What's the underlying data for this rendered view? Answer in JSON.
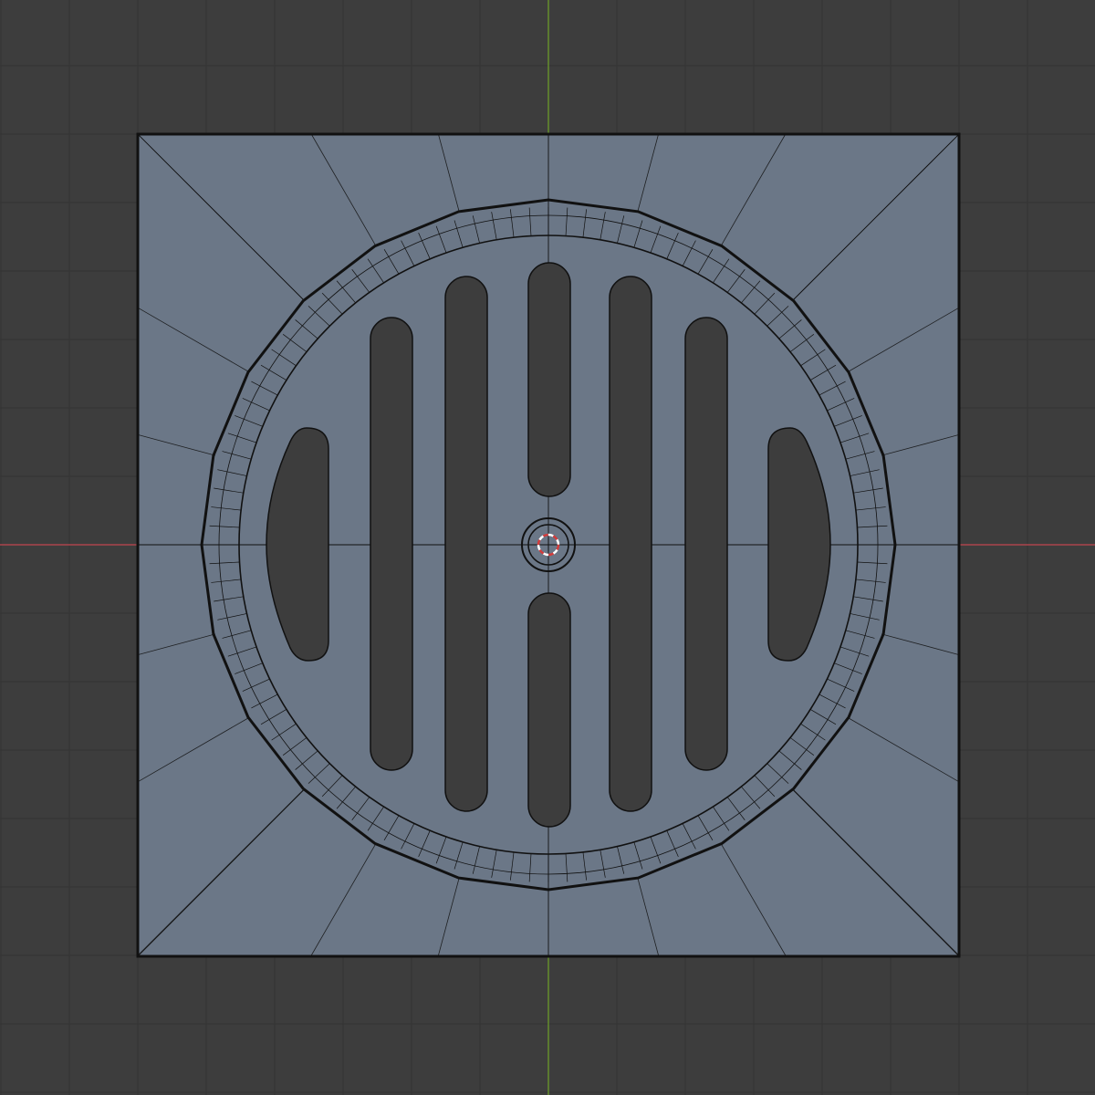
{
  "viewport": {
    "view": "top-orthographic",
    "background_color": "#3d3d3d",
    "grid_color": "#333333",
    "x_axis_color": "#c2464f",
    "y_axis_color": "#6a9a2a",
    "grid_visible": true
  },
  "mesh": {
    "name_icon": "drain-grate-mesh",
    "face_color": "#6b7787",
    "hole_color": "#3d3d3d",
    "edge_color": "#111111",
    "selected": false,
    "radial_edge_count": 24,
    "rim_segment_count": 112,
    "slot_count": 8
  },
  "cursor_3d": {
    "icon": "3d-cursor-icon",
    "ring_colors": [
      "#d23c3c",
      "#ffffff"
    ]
  }
}
